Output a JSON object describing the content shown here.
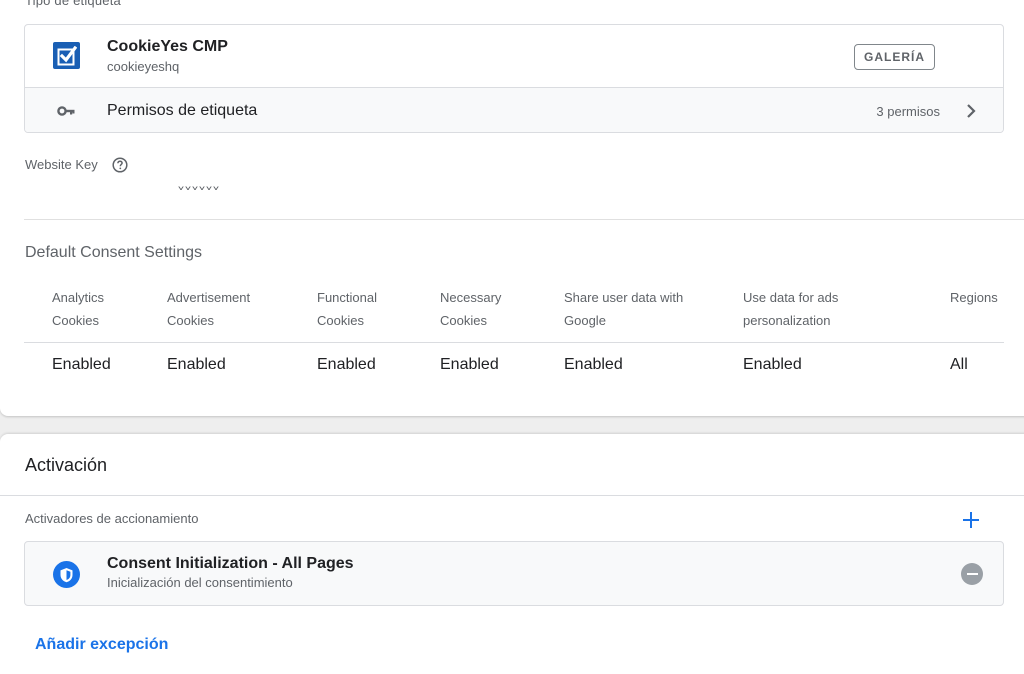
{
  "tag_type": {
    "section_label": "Tipo de etiqueta",
    "name": "CookieYes CMP",
    "vendor": "cookieyeshq",
    "badge": "GALERÍA",
    "permissions_label": "Permisos de etiqueta",
    "permissions_count": "3 permisos"
  },
  "website_key": {
    "label": "Website Key",
    "value": "xxxxxx"
  },
  "consent": {
    "title": "Default Consent Settings",
    "headers": [
      [
        "Analytics",
        "Cookies"
      ],
      [
        "Advertisement",
        "Cookies"
      ],
      [
        "Functional",
        "Cookies"
      ],
      [
        "Necessary",
        "Cookies"
      ],
      [
        "Share user data with",
        "Google"
      ],
      [
        "Use data for ads",
        "personalization"
      ],
      [
        "Regions"
      ]
    ],
    "values": [
      "Enabled",
      "Enabled",
      "Enabled",
      "Enabled",
      "Enabled",
      "Enabled",
      "All"
    ]
  },
  "activation": {
    "title": "Activación",
    "triggers_label": "Activadores de accionamiento",
    "trigger": {
      "name": "Consent Initialization - All Pages",
      "subtitle": "Inicialización del consentimiento"
    },
    "add_exception": "Añadir excepción"
  },
  "colors": {
    "accent": "#1a73e8",
    "logo_blue": "#1a5fb4",
    "text_secondary": "#5f6368"
  },
  "icons": {
    "tag_logo": "cookieyes-check-icon",
    "permissions": "key-icon",
    "help": "help-circle-icon",
    "chevron": "chevron-right-icon",
    "add": "plus-icon",
    "trigger": "shield-icon",
    "remove": "remove-circle-icon"
  }
}
